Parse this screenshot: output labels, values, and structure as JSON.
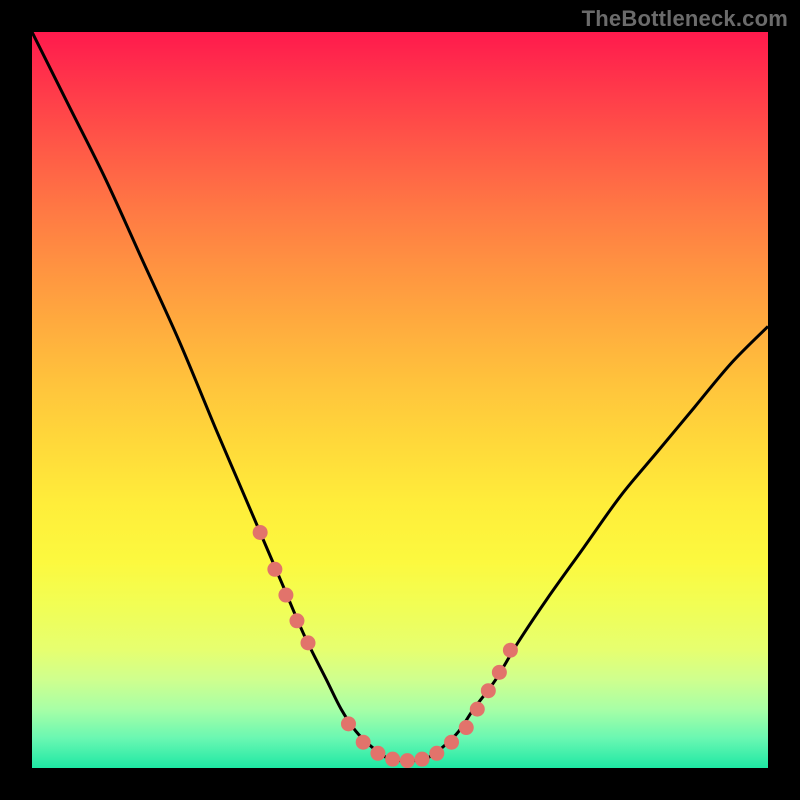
{
  "watermark": "TheBottleneck.com",
  "colors": {
    "frame": "#000000",
    "curve": "#000000",
    "marker": "#e2736b",
    "gradient_top": "#ff1a4d",
    "gradient_bottom": "#1ee8a4"
  },
  "chart_data": {
    "type": "line",
    "title": "",
    "xlabel": "",
    "ylabel": "",
    "xlim": [
      0,
      100
    ],
    "ylim": [
      0,
      100
    ],
    "grid": false,
    "legend": false,
    "annotations": [
      "TheBottleneck.com"
    ],
    "series": [
      {
        "name": "bottleneck-curve",
        "x": [
          0,
          5,
          10,
          15,
          20,
          25,
          28,
          31,
          34,
          37,
          40,
          42,
          44,
          46,
          48,
          50,
          52,
          54,
          56,
          58,
          60,
          63,
          66,
          70,
          75,
          80,
          85,
          90,
          95,
          100
        ],
        "y": [
          100,
          90,
          80,
          69,
          58,
          46,
          39,
          32,
          25,
          18,
          12,
          8,
          5,
          3,
          1.5,
          1,
          1,
          1.5,
          3,
          5,
          8,
          12,
          17,
          23,
          30,
          37,
          43,
          49,
          55,
          60
        ]
      }
    ],
    "markers": {
      "name": "highlight-dots",
      "x": [
        31,
        33,
        34.5,
        36,
        37.5,
        43,
        45,
        47,
        49,
        51,
        53,
        55,
        57,
        59,
        60.5,
        62,
        63.5,
        65
      ],
      "y": [
        32,
        27,
        23.5,
        20,
        17,
        6,
        3.5,
        2,
        1.2,
        1,
        1.2,
        2,
        3.5,
        5.5,
        8,
        10.5,
        13,
        16
      ]
    }
  }
}
